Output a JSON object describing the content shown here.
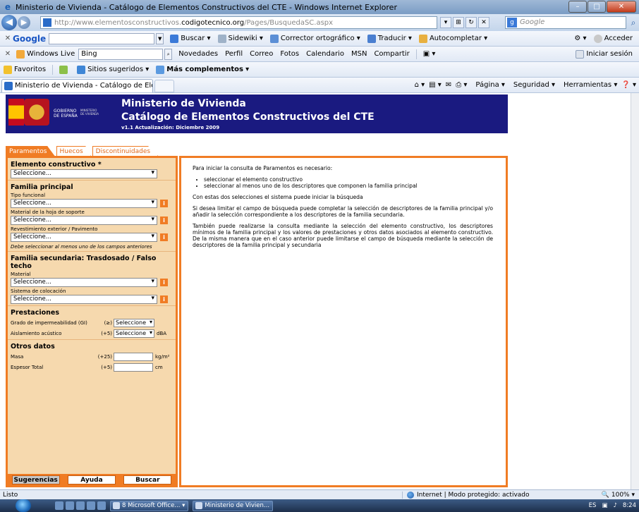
{
  "window": {
    "title": "Ministerio de Vivienda - Catálogo de Elementos Constructivos del CTE - Windows Internet Explorer",
    "url_prefix": "http://www.elementosconstructivos.",
    "url_domain": "codigotecnico.org",
    "url_path": "/Pages/BusquedaSC.aspx",
    "search_placeholder": "Google",
    "min": "–",
    "max": "□",
    "close": "✕"
  },
  "google_bar": {
    "brand": "Google",
    "buscar": "Buscar",
    "sidewiki": "Sidewiki",
    "corrector": "Corrector ortográfico",
    "traducir": "Traducir",
    "autocompletar": "Autocompletar",
    "acceder": "Acceder"
  },
  "wl_bar": {
    "brand": "Windows Live",
    "search_value": "Bing",
    "items": [
      "Novedades",
      "Perfil",
      "Correo",
      "Fotos",
      "Calendario",
      "MSN",
      "Compartir"
    ],
    "iniciar": "Iniciar sesión"
  },
  "fav_bar": {
    "favoritos": "Favoritos",
    "sitios": "Sitios sugeridos",
    "mas": "Más complementos"
  },
  "tab_bar": {
    "tab_label": "Ministerio de Vivienda - Catálogo de Elementos ...",
    "pagina": "Página",
    "seguridad": "Seguridad",
    "herramientas": "Herramientas"
  },
  "banner": {
    "gobierno_1": "GOBIERNO",
    "gobierno_2": "DE ESPAÑA",
    "ministerio_1": "MINISTERIO",
    "ministerio_2": "DE VIVIENDA",
    "title": "Ministerio de Vivienda",
    "subtitle": "Catálogo de Elementos Constructivos del CTE",
    "version": "v1.1 Actualización: Diciembre 2009"
  },
  "tabs": {
    "paramentos": "Paramentos",
    "huecos": "Huecos",
    "discontinuidades": "Discontinuidades"
  },
  "form": {
    "elemento_title": "Elemento constructivo *",
    "select_default": "Seleccione...",
    "familia_principal": "Familia principal",
    "tipo_funcional": "Tipo funcional",
    "material_hoja": "Material de la hoja de soporte",
    "revestimiento": "Revestimiento exterior / Pavimento",
    "note": "Debe seleccionar al menos uno de los campos anteriores",
    "familia_secundaria": "Familia secundaria: Trasdosado / Falso techo",
    "material": "Material",
    "sistema": "Sistema de colocación",
    "info": "i",
    "prestaciones": "Prestaciones",
    "grado": "Grado de impermeabilidad (GI)",
    "grado_op": "(≥)",
    "small_select": "Seleccione",
    "aislamiento": "Aislamiento acústico",
    "aislamiento_op": "(+5)",
    "aislamiento_unit": "dBA",
    "otros": "Otros datos",
    "masa": "Masa",
    "masa_op": "(+25)",
    "masa_unit": "kg/m²",
    "espesor": "Espesor Total",
    "espesor_op": "(+5)",
    "espesor_unit": "cm"
  },
  "buttons": {
    "sugerencias": "Sugerencias",
    "ayuda": "Ayuda",
    "buscar": "Buscar"
  },
  "help": {
    "intro": "Para iniciar la consulta de Paramentos es necesario:",
    "bullet1": "seleccionar el elemento constructivo",
    "bullet2": "seleccionar al menos uno de los descriptores que componen la familia principal",
    "p2": "Con estas dos selecciones el sistema puede iniciar la búsqueda",
    "p3": "Si desea limitar el campo de búsqueda puede completar la selección de descriptores de la familia principal y/o añadir la selección correspondiente a los descriptores de la familia secundaria.",
    "p4": "También puede realizarse la consulta mediante la selección del elemento constructivo, los descriptores mínimos de la familia principal y los valores de prestaciones y otros datos asociados al elemento constructivo. De la misma manera que en el caso anterior puede limitarse el campo de búsqueda mediante la selección de descriptores de la familia principal y secundaria"
  },
  "status": {
    "ready": "Listo",
    "zone": "Internet | Modo protegido: activado",
    "zoom": "100%"
  },
  "taskbar": {
    "office": "8 Microsoft Office...",
    "ie": "Ministerio de Vivien...",
    "lang": "ES",
    "time": "8:24"
  }
}
